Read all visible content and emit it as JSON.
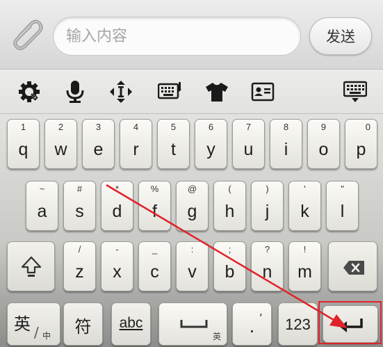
{
  "input_bar": {
    "placeholder": "输入内容",
    "send_label": "发送"
  },
  "toolbar": {
    "icons": [
      "settings-gear-icon",
      "microphone-icon",
      "cursor-move-icon",
      "keyboard-layout-icon",
      "skin-shirt-icon",
      "contact-card-icon",
      "hide-keyboard-icon"
    ]
  },
  "keys": {
    "row1": [
      {
        "main": "q",
        "sub": "1"
      },
      {
        "main": "w",
        "sub": "2"
      },
      {
        "main": "e",
        "sub": "3"
      },
      {
        "main": "r",
        "sub": "4"
      },
      {
        "main": "t",
        "sub": "5"
      },
      {
        "main": "y",
        "sub": "6"
      },
      {
        "main": "u",
        "sub": "7"
      },
      {
        "main": "i",
        "sub": "8"
      },
      {
        "main": "o",
        "sub": "9"
      },
      {
        "main": "p",
        "sub": "0"
      }
    ],
    "row2": [
      {
        "main": "a",
        "sub": "~"
      },
      {
        "main": "s",
        "sub": "#"
      },
      {
        "main": "d",
        "sub": "*"
      },
      {
        "main": "f",
        "sub": "%"
      },
      {
        "main": "g",
        "sub": "@"
      },
      {
        "main": "h",
        "sub": "("
      },
      {
        "main": "j",
        "sub": ")"
      },
      {
        "main": "k",
        "sub": "'"
      },
      {
        "main": "l",
        "sub": "\""
      }
    ],
    "row3": [
      {
        "main": "z",
        "sub": "/"
      },
      {
        "main": "x",
        "sub": "-"
      },
      {
        "main": "c",
        "sub": "_"
      },
      {
        "main": "v",
        "sub": ":"
      },
      {
        "main": "b",
        "sub": ";"
      },
      {
        "main": "n",
        "sub": "?"
      },
      {
        "main": "m",
        "sub": "!"
      }
    ],
    "lang_main": "英",
    "lang_sub": "中",
    "symbol": "符",
    "abc": "abc",
    "space_sub": "英",
    "period": ".",
    "period_sub": ",",
    "num": "123"
  },
  "colors": {
    "annotation": "#e0222a"
  }
}
